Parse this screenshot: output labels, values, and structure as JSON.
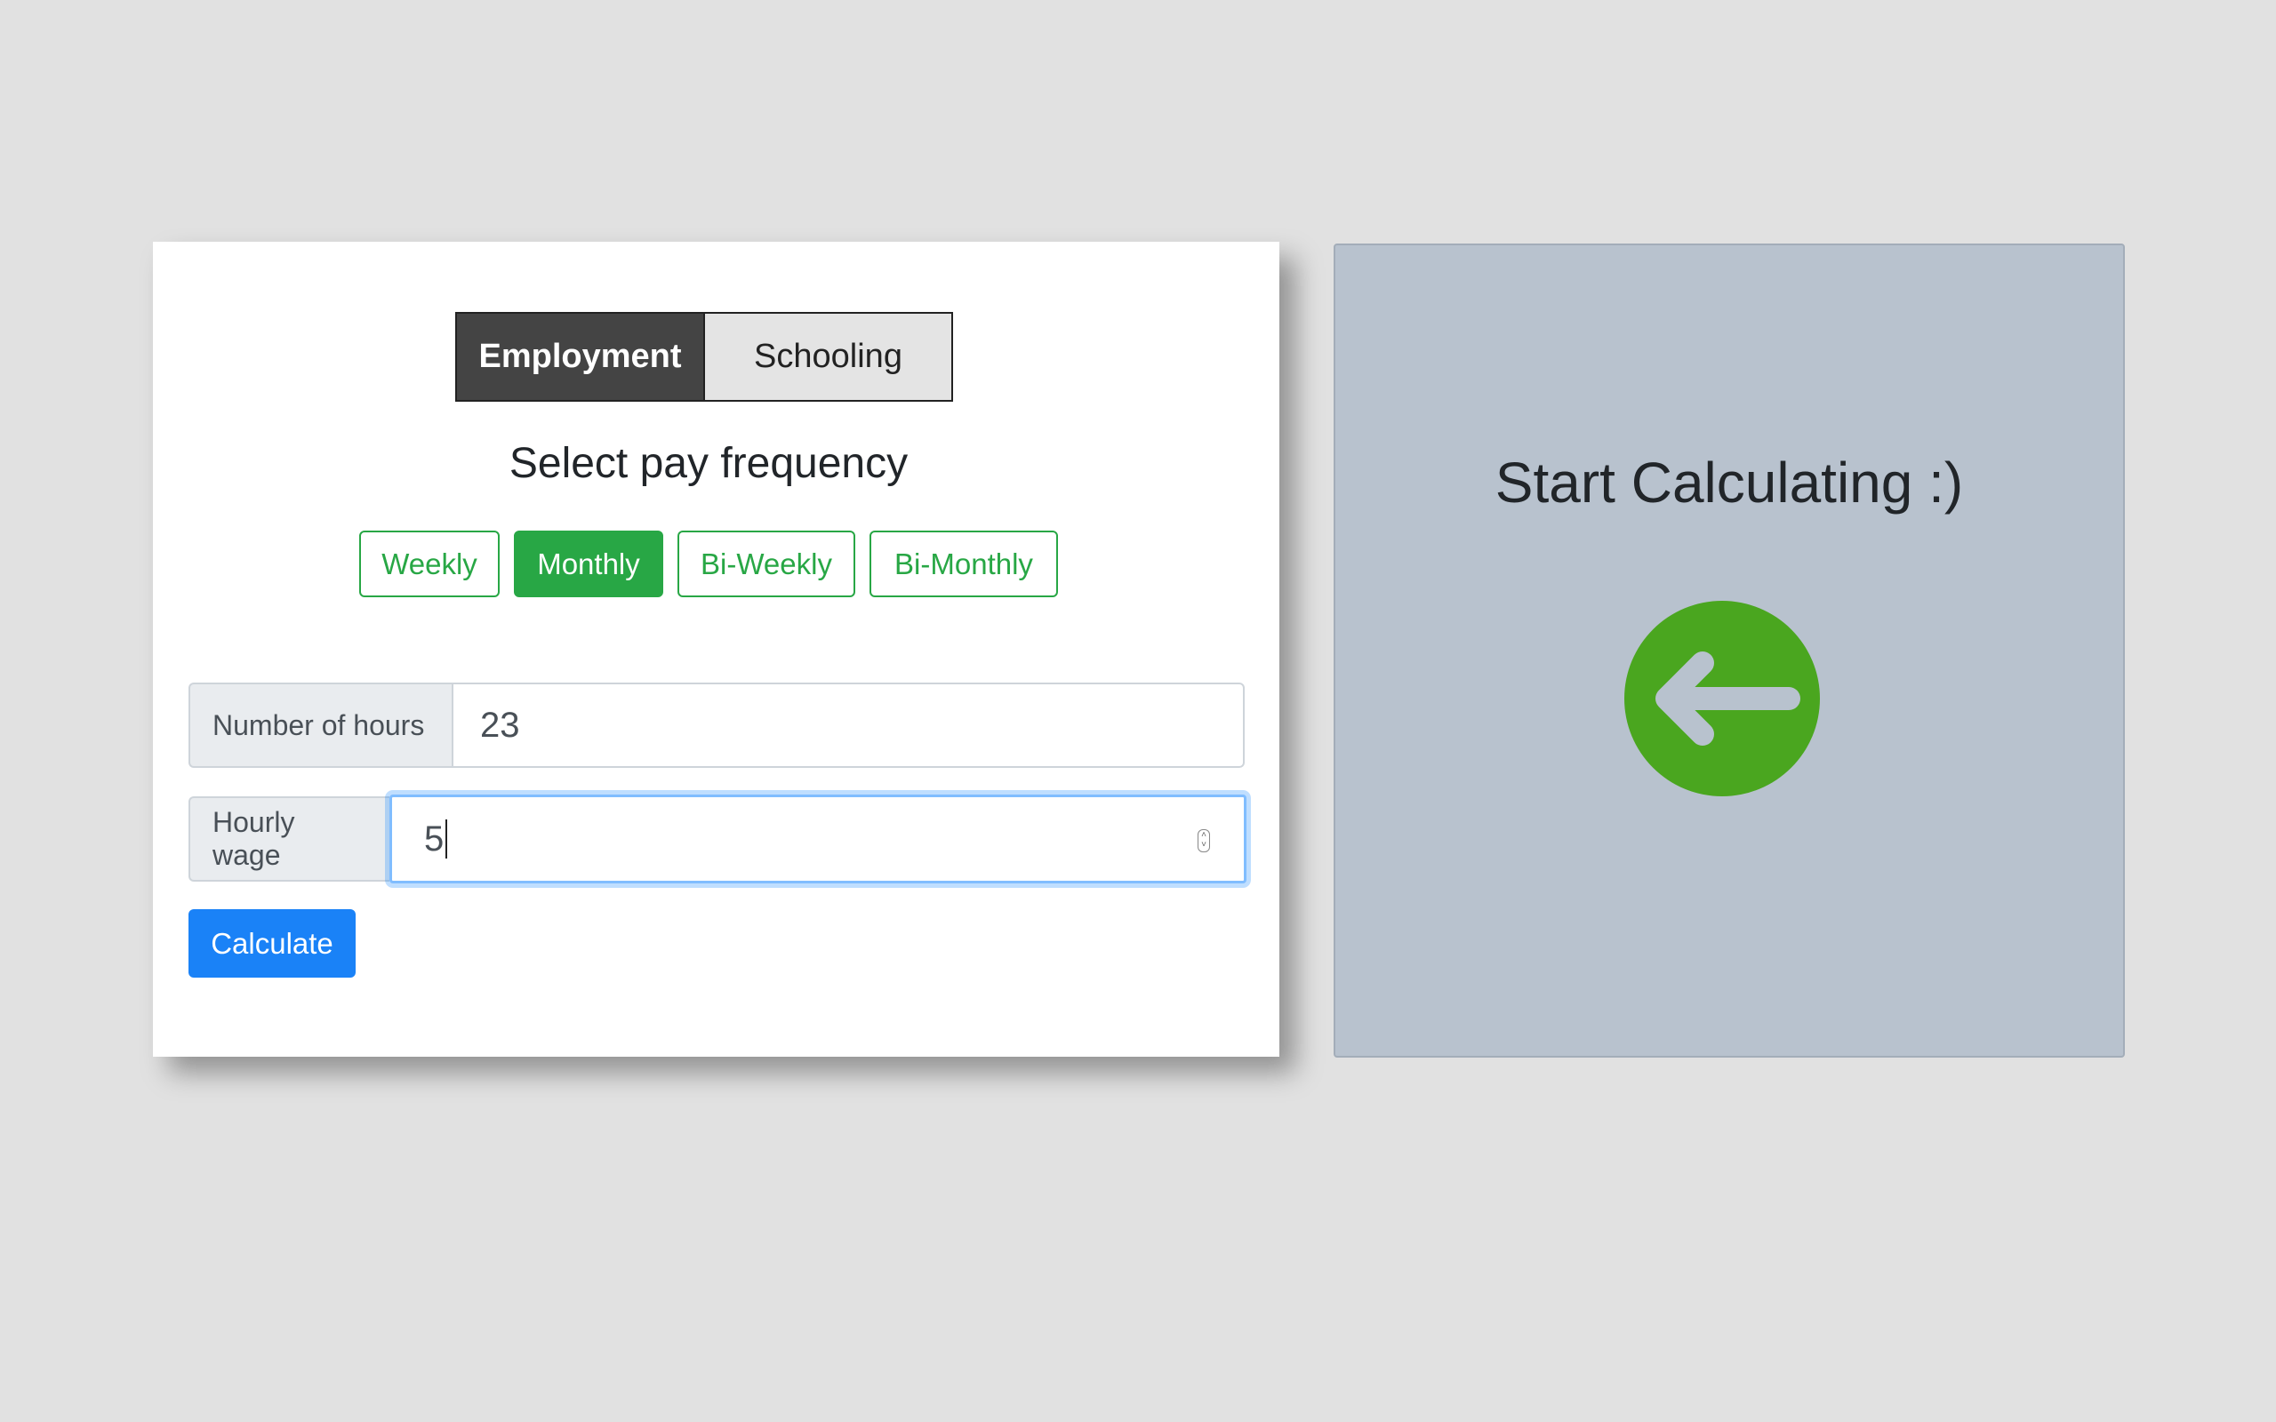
{
  "mode_tabs": {
    "employment_label": "Employment",
    "schooling_label": "Schooling",
    "active": "Employment"
  },
  "pay_frequency": {
    "title": "Select pay frequency",
    "options": [
      "Weekly",
      "Monthly",
      "Bi-Weekly",
      "Bi-Monthly"
    ],
    "selected": "Monthly"
  },
  "hours": {
    "label": "Number of hours",
    "value": "23"
  },
  "wage": {
    "label": "Hourly wage",
    "value": "5"
  },
  "calculate_label": "Calculate",
  "result": {
    "title": "Start Calculating :)",
    "icon": "arrow-left-circle-icon"
  },
  "colors": {
    "background": "#e1e1e1",
    "success_green": "#28a745",
    "primary_blue": "#1a82f7",
    "active_tab": "#444444",
    "result_panel": "#b8c2ce",
    "arrow_circle": "#4aa61f"
  }
}
